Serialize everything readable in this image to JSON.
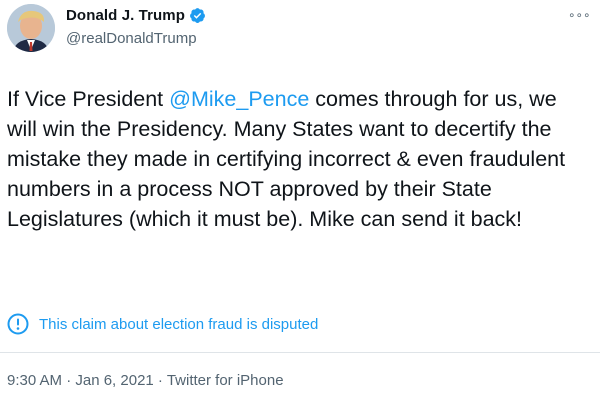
{
  "author": {
    "display_name": "Donald J. Trump",
    "handle": "@realDonaldTrump",
    "verified_icon": "verified-badge-icon"
  },
  "tweet": {
    "text_before_mention": "If Vice President ",
    "mention": "@Mike_Pence",
    "text_after_mention": " comes through for us, we will win the Presidency. Many States want to decertify the mistake they made in certifying incorrect & even fraudulent numbers in a process  NOT approved by their State Legislatures (which it must be). Mike can send it back!"
  },
  "notice": {
    "icon": "info-icon",
    "text": "This claim about election fraud is disputed"
  },
  "meta": {
    "timestamp": "9:30 AM · Jan 6, 2021 · Twitter for iPhone"
  },
  "more_menu": {
    "label": "∘∘∘"
  },
  "colors": {
    "accent": "#1d9bf0",
    "text": "#0f1419",
    "muted": "#536471"
  }
}
